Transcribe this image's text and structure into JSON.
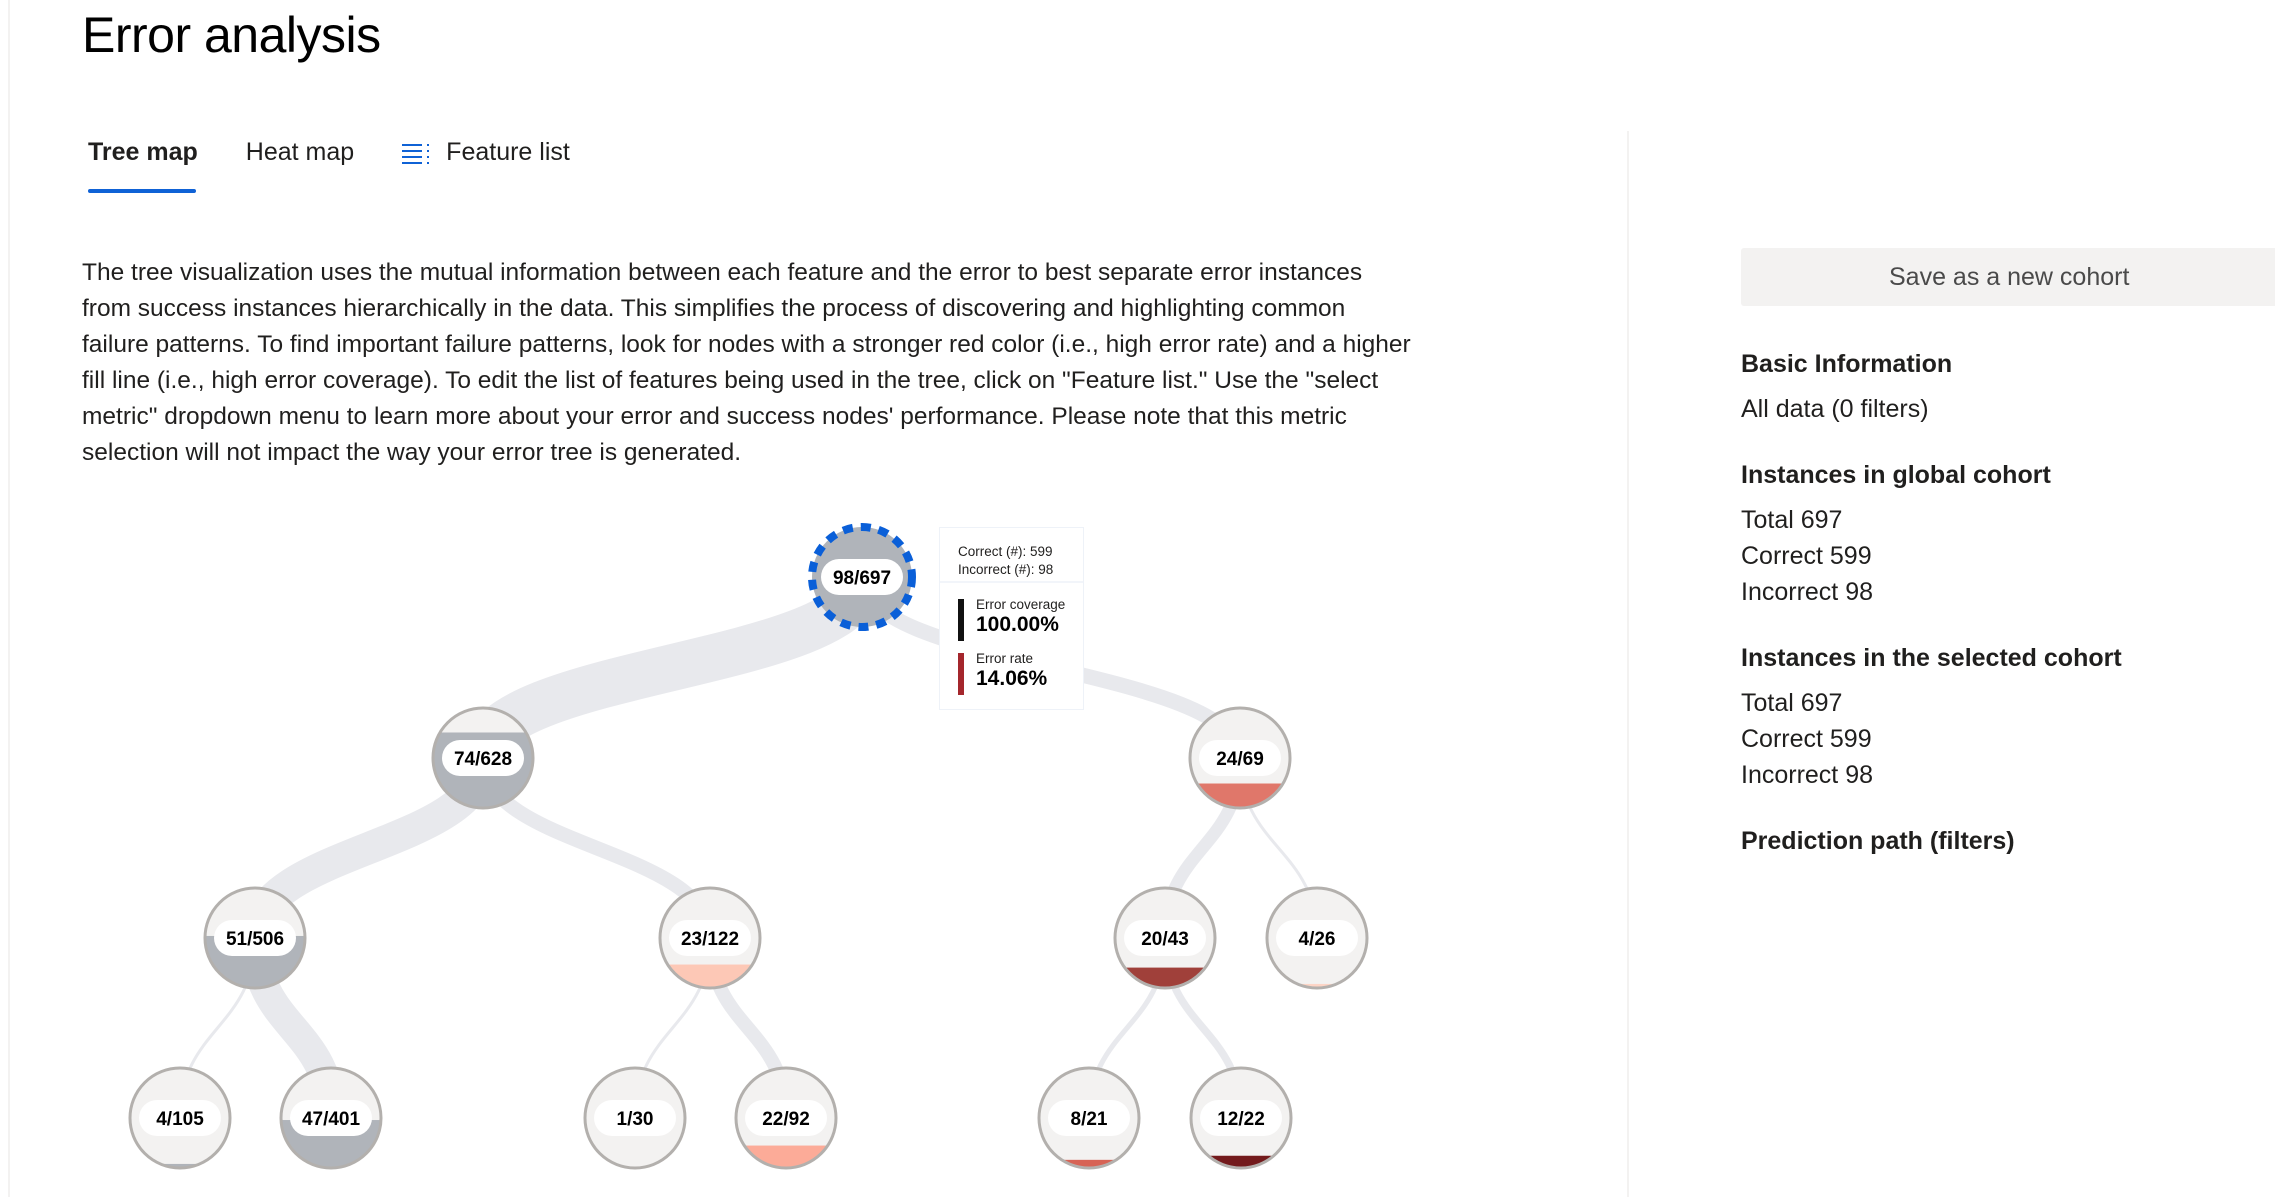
{
  "page": {
    "title": "Error analysis"
  },
  "tabs": [
    {
      "label": "Tree map",
      "active": true
    },
    {
      "label": "Heat map",
      "active": false
    },
    {
      "label": "Feature list",
      "icon": "list-icon",
      "active": false
    }
  ],
  "description": "The tree visualization uses the mutual information between each feature and the error to best separate error instances from success instances hierarchically in the data. This simplifies the process of discovering and highlighting common failure patterns. To find important failure patterns, look for nodes with a stronger red color (i.e., high error rate) and a higher fill line (i.e., high error coverage). To edit the list of features being used in the tree, click on \"Feature list.\" Use the \"select metric\" dropdown menu to learn more about your error and success nodes' performance. Please note that this metric selection will not impact the way your error tree is generated.",
  "colors": {
    "accent": "#0f62d6",
    "selected_node_stroke": "#0a5fd8",
    "node_background": "#f3f2f1",
    "node_border": "#b3b0ad",
    "link": "#e8e9ed",
    "low_error_fill": "#b0b4ba",
    "coverage_bar": "#111111",
    "rate_bar": "#a4262c"
  },
  "tree": {
    "selected_node": "root",
    "nodes": [
      {
        "id": "root",
        "label": "98/697",
        "incorrect": 98,
        "total": 697,
        "parent": null,
        "depth": 0,
        "color": "#b0b4ba"
      },
      {
        "id": "n1",
        "label": "74/628",
        "incorrect": 74,
        "total": 628,
        "parent": "root",
        "depth": 1,
        "color": "#b0b4ba"
      },
      {
        "id": "n2",
        "label": "24/69",
        "incorrect": 24,
        "total": 69,
        "parent": "root",
        "depth": 1,
        "color": "#e0776a"
      },
      {
        "id": "n3",
        "label": "51/506",
        "incorrect": 51,
        "total": 506,
        "parent": "n1",
        "depth": 2,
        "color": "#b0b4ba"
      },
      {
        "id": "n4",
        "label": "23/122",
        "incorrect": 23,
        "total": 122,
        "parent": "n1",
        "depth": 2,
        "color": "#fdc8b6"
      },
      {
        "id": "n5",
        "label": "20/43",
        "incorrect": 20,
        "total": 43,
        "parent": "n2",
        "depth": 2,
        "color": "#a0403a"
      },
      {
        "id": "n6",
        "label": "4/26",
        "incorrect": 4,
        "total": 26,
        "parent": "n2",
        "depth": 2,
        "color": "#fdd5c6"
      },
      {
        "id": "n7",
        "label": "4/105",
        "incorrect": 4,
        "total": 105,
        "parent": "n3",
        "depth": 3,
        "color": "#b0b4ba"
      },
      {
        "id": "n8",
        "label": "47/401",
        "incorrect": 47,
        "total": 401,
        "parent": "n3",
        "depth": 3,
        "color": "#b0b4ba"
      },
      {
        "id": "n9",
        "label": "1/30",
        "incorrect": 1,
        "total": 30,
        "parent": "n4",
        "depth": 3,
        "color": "#f6d0c4"
      },
      {
        "id": "n10",
        "label": "22/92",
        "incorrect": 22,
        "total": 92,
        "parent": "n4",
        "depth": 3,
        "color": "#fcab98"
      },
      {
        "id": "n11",
        "label": "8/21",
        "incorrect": 8,
        "total": 21,
        "parent": "n5",
        "depth": 3,
        "color": "#d76355"
      },
      {
        "id": "n12",
        "label": "12/22",
        "incorrect": 12,
        "total": 22,
        "parent": "n5",
        "depth": 3,
        "color": "#731a1c"
      }
    ]
  },
  "tooltip": {
    "correct_line": "Correct (#): 599",
    "incorrect_line": "Incorrect (#): 98",
    "coverage_label": "Error coverage",
    "coverage_value": "100.00%",
    "rate_label": "Error rate",
    "rate_value": "14.06%"
  },
  "side_panel": {
    "save_button": "Save as a new cohort",
    "basic_info": {
      "heading": "Basic Information",
      "lines": [
        "All data (0 filters)"
      ]
    },
    "global_cohort": {
      "heading": "Instances in global cohort",
      "lines": [
        "Total 697",
        "Correct 599",
        "Incorrect 98"
      ]
    },
    "selected_cohort": {
      "heading": "Instances in the selected cohort",
      "lines": [
        "Total 697",
        "Correct 599",
        "Incorrect 98"
      ]
    },
    "prediction_path": {
      "heading": "Prediction path (filters)"
    }
  }
}
